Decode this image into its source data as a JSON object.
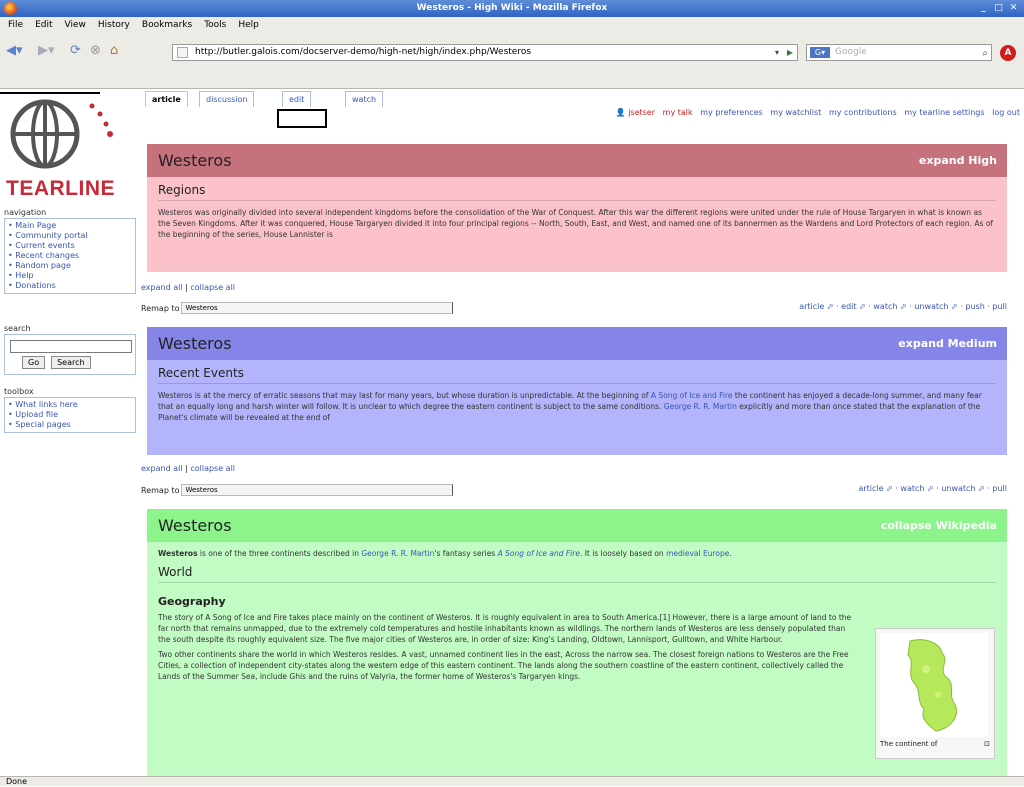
{
  "window": {
    "title": "Westeros - High Wiki - Mozilla Firefox"
  },
  "menu": [
    "File",
    "Edit",
    "View",
    "History",
    "Bookmarks",
    "Tools",
    "Help"
  ],
  "url": "http://butler.galois.com/docserver-demo/high-net/high/index.php/Westeros",
  "search_placeholder": "Google",
  "personal": {
    "user": "jsetser",
    "links": [
      "my talk",
      "my preferences",
      "my watchlist",
      "my contributions",
      "my tearline settings",
      "log out"
    ]
  },
  "tabs": [
    "article",
    "discussion",
    "edit",
    "watch"
  ],
  "edit_link": "edit",
  "logo_text": "TEARLINE",
  "sidebar": {
    "navigation_title": "navigation",
    "navigation": [
      "Main Page",
      "Community portal",
      "Current events",
      "Recent changes",
      "Random page",
      "Help",
      "Donations"
    ],
    "search_title": "search",
    "go_label": "Go",
    "search_label": "Search",
    "toolbox_title": "toolbox",
    "toolbox": [
      "What links here",
      "Upload file",
      "Special pages"
    ]
  },
  "panels": [
    {
      "title": "Westeros",
      "expand": "expand High",
      "section": "Regions",
      "text": "Westeros was originally divided into several independent kingdoms before the consolidation of the War of Conquest. After this war the different regions were united under the rule of House Targaryen in what is known as the Seven Kingdoms. After it was conquered, House Targaryen divided it into four principal regions -- North, South, East, and West, and named one of its bannermen as the Wardens and Lord Protectors of each region. As of the beginning of the series, House Lannister is"
    },
    {
      "title": "Westeros",
      "expand": "expand Medium",
      "section": "Recent Events",
      "text_a": "Westeros is at the mercy of erratic seasons that may last for many years, but whose duration is unpredictable. At the beginning of ",
      "link_a": "A Song of Ice and Fire",
      "text_b": " the continent has enjoyed a decade-long summer, and many fear that an equally long and harsh winter will follow. It is unclear to which degree the eastern continent is subject to the same conditions. ",
      "link_b": "George R. R. Martin",
      "text_c": " explicitly and more than once stated that the explanation of the Planet's climate will be revealed at the end of"
    },
    {
      "title": "Westeros",
      "expand": "collapse Wikipedia",
      "intro_bold": "Westeros",
      "intro_a": " is one of the three continents described in ",
      "intro_link1": "George R. R. Martin",
      "intro_b": "'s fantasy series ",
      "intro_link2": "A Song of Ice and Fire",
      "intro_c": ". It is loosely based on ",
      "intro_link3": "medieval Europe",
      "intro_d": ".",
      "section": "World",
      "subsection": "Geography",
      "p1": "The story of A Song of Ice and Fire takes place mainly on the continent of Westeros. It is roughly equivalent in area to South America.[1] However, there is a large amount of land to the far north that remains unmapped, due to the extremely cold temperatures and hostile inhabitants known as wildlings. The northern lands of Westeros are less densely populated than the south despite its roughly equivalent size. The five major cities of Westeros are, in order of size: King's Landing, Oldtown, Lannisport, Gulltown, and White Harbour.",
      "p2": "Two other continents share the world in which Westeros resides. A vast, unnamed continent lies in the east, Across the narrow sea. The closest foreign nations to Westeros are the Free Cities, a collection of independent city-states along the western edge of this eastern continent. The lands along the southern coastline of the eastern continent, collectively called the Lands of the Summer Sea, include Ghis and the ruins of Valyria, the former home of Westeros's Targaryen kings.",
      "caption": "The continent of"
    }
  ],
  "bars": [
    {
      "expand_all": "expand all",
      "collapse_all": "collapse all",
      "remap_label": "Remap to",
      "remap_value": "Westeros",
      "actions": "article ⬀ · edit ⬀ · watch ⬀ · unwatch ⬀ · push · pull"
    },
    {
      "expand_all": "expand all",
      "collapse_all": "collapse all",
      "remap_label": "Remap to",
      "remap_value": "Westeros",
      "actions": "article ⬀ · watch ⬀ · unwatch ⬀ · pull"
    }
  ],
  "status": "Done",
  "colors": {
    "high_head": "#c5727c",
    "high_body": "#fcc2cb",
    "medium_head": "#8585e8",
    "medium_body": "#b3b4fb",
    "wiki_head": "#8cf48b",
    "wiki_body": "#c2fcc4"
  }
}
